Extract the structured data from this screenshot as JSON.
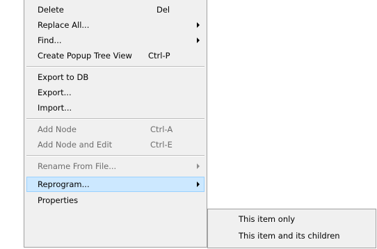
{
  "menu": {
    "items": [
      {
        "label": "Delete",
        "shortcut": "Del"
      },
      {
        "label": "Replace All..."
      },
      {
        "label": "Find..."
      },
      {
        "label": "Create Popup Tree View",
        "shortcut": "Ctrl-P"
      },
      {
        "label": "Export to DB"
      },
      {
        "label": "Export..."
      },
      {
        "label": "Import..."
      },
      {
        "label": "Add Node",
        "shortcut": "Ctrl-A"
      },
      {
        "label": "Add Node and Edit",
        "shortcut": "Ctrl-E"
      },
      {
        "label": "Rename From File..."
      },
      {
        "label": "Reprogram..."
      },
      {
        "label": "Properties"
      }
    ]
  },
  "submenu": {
    "items": [
      {
        "label": "This item only"
      },
      {
        "label": "This item and its children"
      }
    ]
  }
}
